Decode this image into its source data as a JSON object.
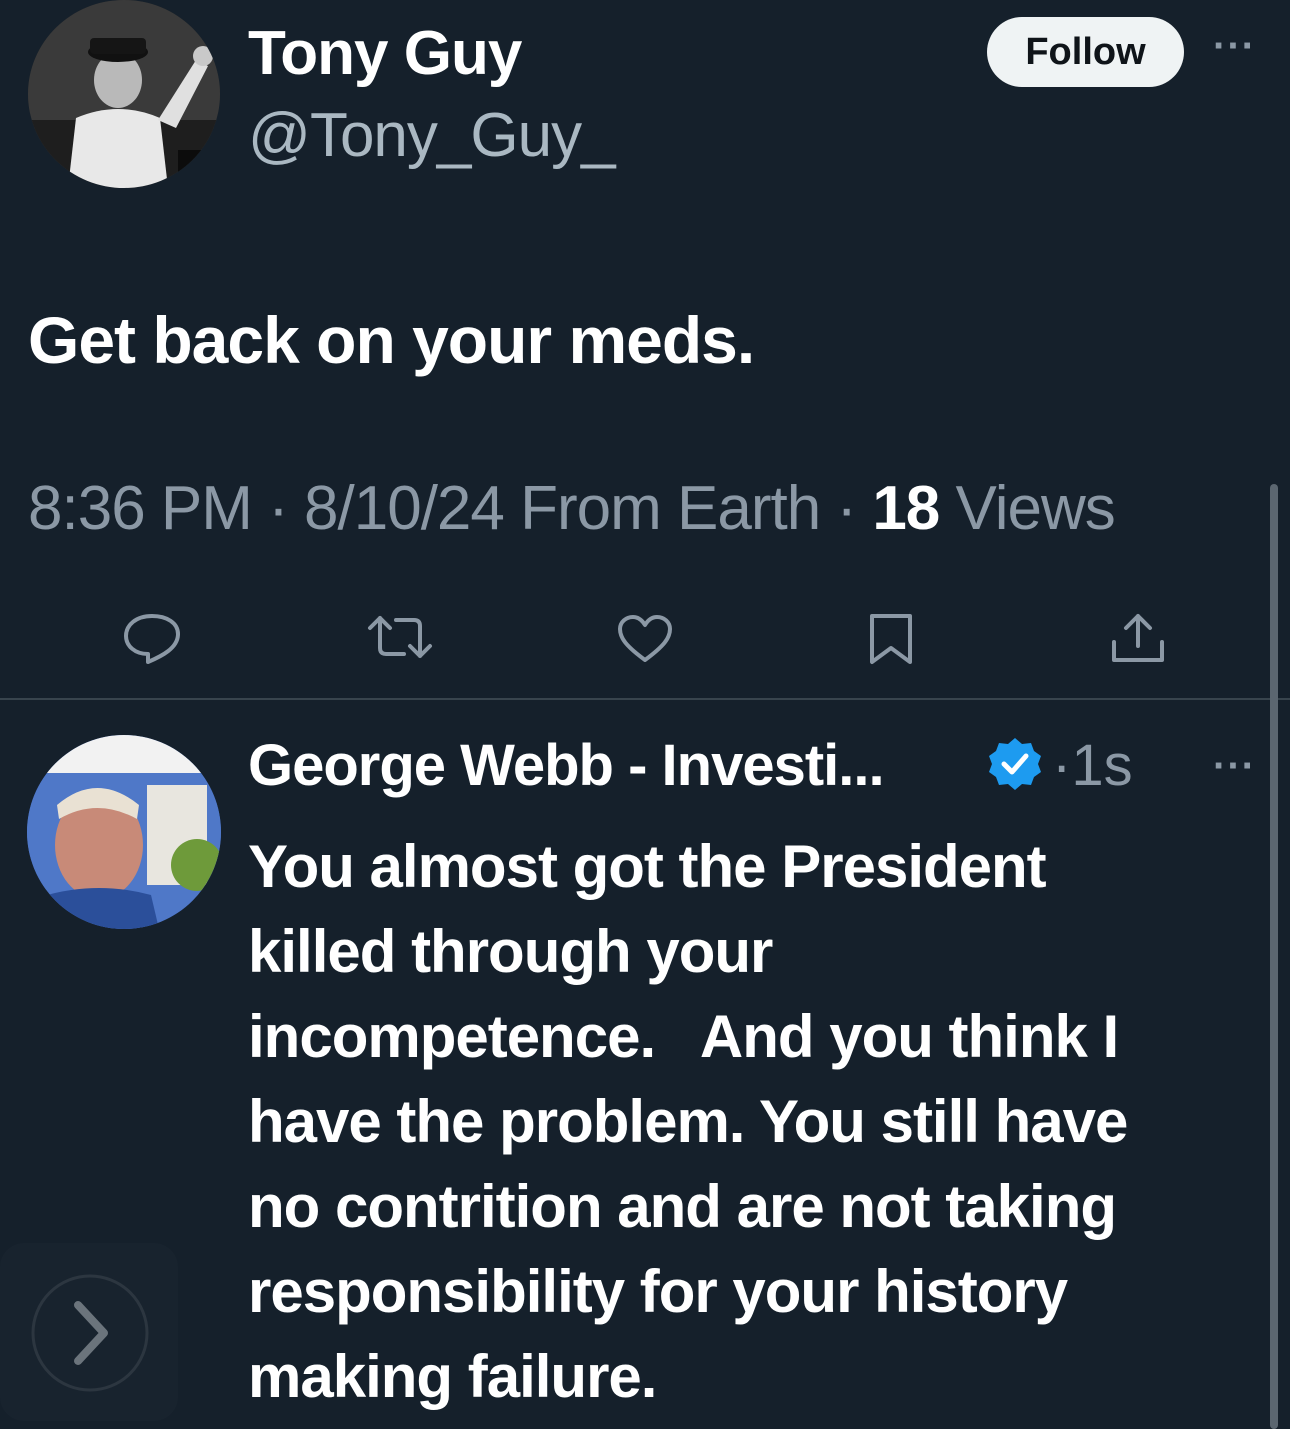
{
  "tweet": {
    "author_name": "Tony Guy",
    "author_handle": "@Tony_Guy_",
    "follow_label": "Follow",
    "more_label": "···",
    "text": "Get back on your meds.",
    "time": "8:36 PM",
    "date": "8/10/24",
    "source": "From Earth",
    "views_count": "18",
    "views_label": "Views",
    "separator": "·"
  },
  "actions": [
    "reply-icon",
    "retweet-icon",
    "like-icon",
    "bookmark-icon",
    "share-icon"
  ],
  "reply": {
    "author_name": "George Webb - Investi...",
    "verified": "verified-badge-icon",
    "time": "1s",
    "more_label": "···",
    "lines": [
      "You almost got the President",
      "killed through your",
      "incompetence.   And you think I",
      "have the problem. You still have",
      "no contrition and are not taking",
      "responsibility for your history",
      "making failure."
    ]
  },
  "colors": {
    "background": "#15202b",
    "secondary_text": "#8b98a5",
    "verified": "#1d9bf0"
  }
}
